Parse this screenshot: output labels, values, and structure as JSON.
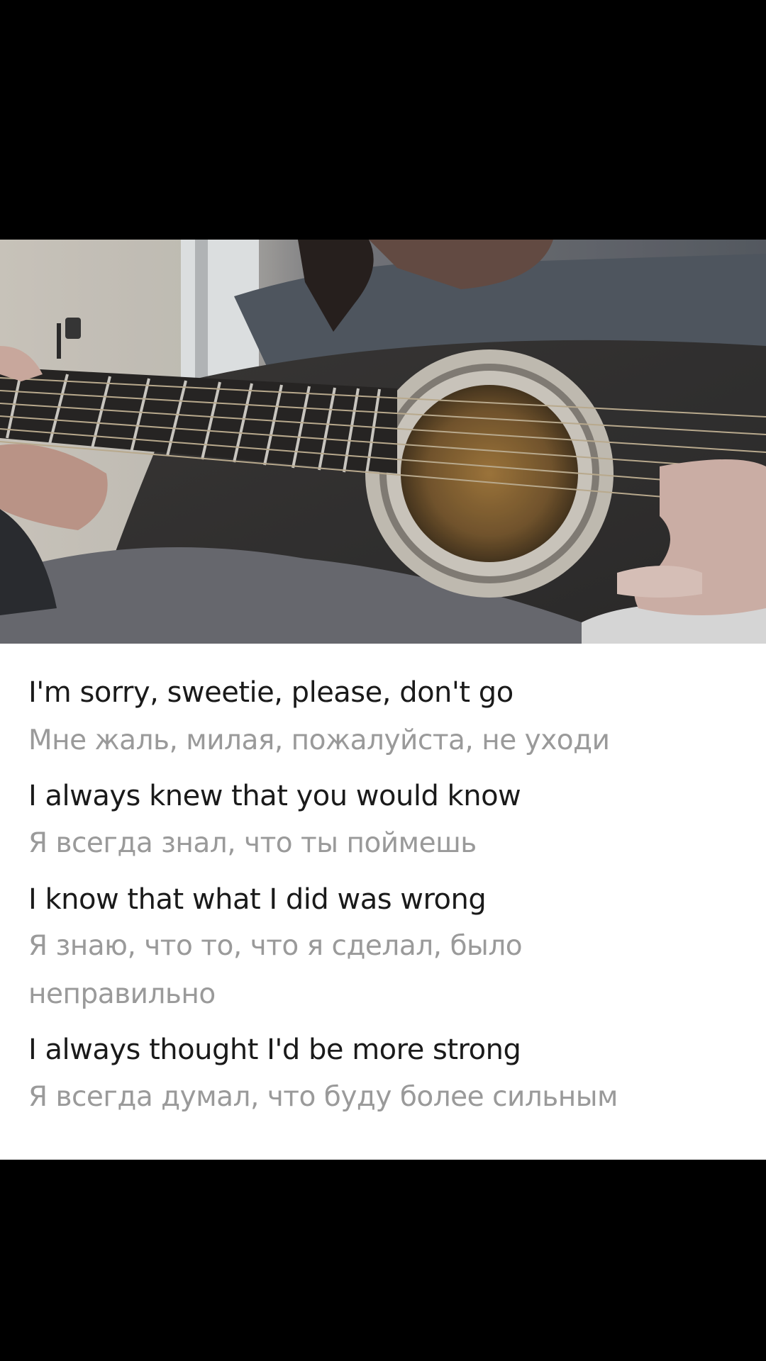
{
  "video": {
    "scene": "guitar-playing-closeup",
    "colors": {
      "letterbox": "#000000",
      "panel_background": "#ffffff",
      "original_text": "#1a1a1a",
      "translation_text": "#9a9a9a"
    }
  },
  "lyrics": [
    {
      "original": "I'm sorry, sweetie, please, don't go",
      "translation": "Мне жаль, милая, пожалуйста, не уходи"
    },
    {
      "original": "I always knew that you would know",
      "translation": "Я всегда знал, что ты поймешь"
    },
    {
      "original": "I know that what I did was wrong",
      "translation_line1": "Я знаю, что то, что я сделал, было",
      "translation_line2": "неправильно"
    },
    {
      "original": "I always thought I'd be more strong",
      "translation": "Я всегда думал, что буду более сильным"
    }
  ]
}
